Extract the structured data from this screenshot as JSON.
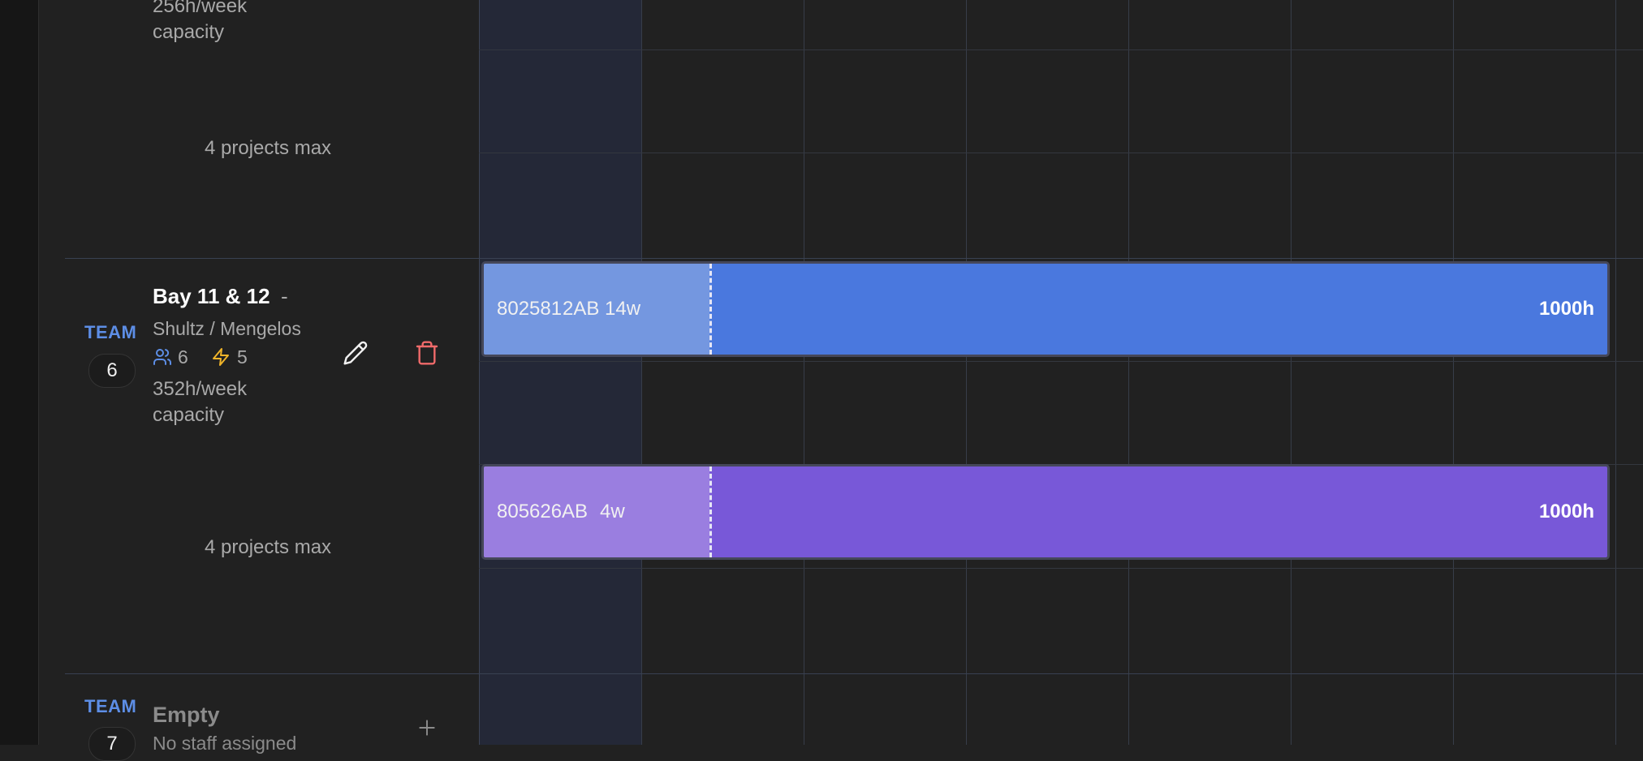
{
  "colors": {
    "background": "#212121",
    "team_accent": "#5d8ee6",
    "staff_icon": "#5d8ee6",
    "energy_icon": "#f0b429",
    "delete_icon": "#f06a6a",
    "project_blue_head": "#7497e0",
    "project_blue_body": "#4a78de",
    "project_purple_head": "#9a7ee0",
    "project_purple_body": "#7858d8"
  },
  "team5": {
    "capacity_line1": "256h/week",
    "capacity_line2": "capacity",
    "projects_max": "4 projects max"
  },
  "team6": {
    "label": "TEAM",
    "number": "6",
    "title": "Bay 11 & 12",
    "title_suffix": "-",
    "subtitle": "Shultz / Mengelos",
    "staff_count": "6",
    "energy_count": "5",
    "capacity_line1": "352h/week",
    "capacity_line2": "capacity",
    "projects_max": "4 projects max",
    "icons": {
      "staff": "users-icon",
      "energy": "lightning-icon",
      "edit": "pencil-icon",
      "delete": "trash-icon"
    }
  },
  "team7": {
    "label": "TEAM",
    "number": "7",
    "title": "Empty",
    "subtitle": "No staff assigned",
    "icons": {
      "add": "plus-icon"
    }
  },
  "projects": [
    {
      "id": "802581",
      "id_overlap": "2AB",
      "duration": "14w",
      "hours": "1000h"
    },
    {
      "id": "805626",
      "id_overlap": "AB",
      "duration": "4w",
      "hours": "1000h"
    }
  ]
}
